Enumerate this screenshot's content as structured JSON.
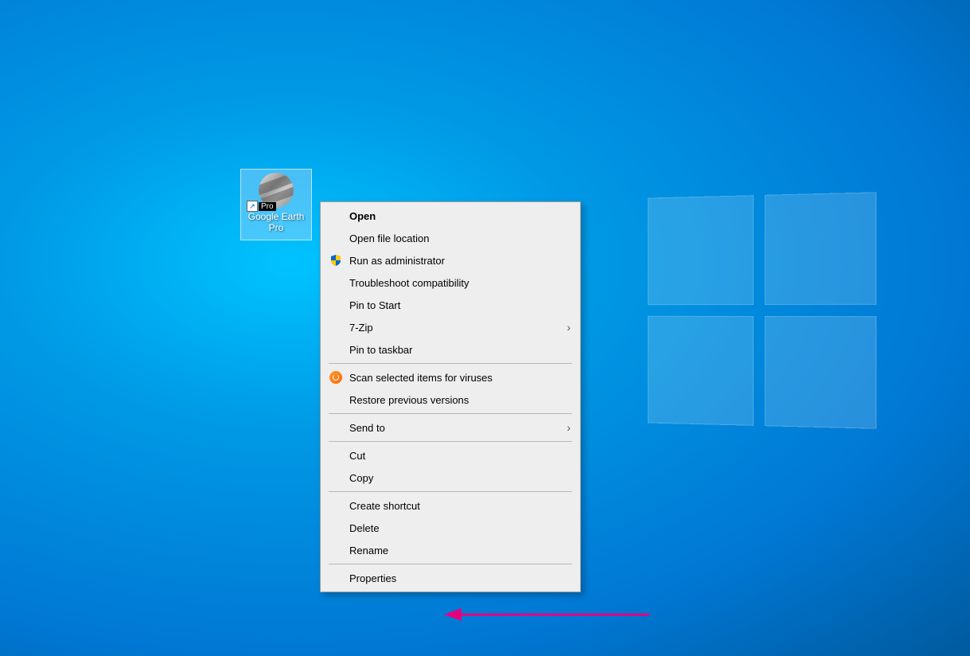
{
  "desktop_icon": {
    "label": "Google Earth Pro",
    "badge": "Pro"
  },
  "context_menu": {
    "items": [
      {
        "label": "Open",
        "bold": true,
        "icon": null,
        "submenu": false
      },
      {
        "label": "Open file location",
        "bold": false,
        "icon": null,
        "submenu": false
      },
      {
        "label": "Run as administrator",
        "bold": false,
        "icon": "shield",
        "submenu": false
      },
      {
        "label": "Troubleshoot compatibility",
        "bold": false,
        "icon": null,
        "submenu": false
      },
      {
        "label": "Pin to Start",
        "bold": false,
        "icon": null,
        "submenu": false
      },
      {
        "label": "7-Zip",
        "bold": false,
        "icon": null,
        "submenu": true
      },
      {
        "label": "Pin to taskbar",
        "bold": false,
        "icon": null,
        "submenu": false
      },
      {
        "separator": true
      },
      {
        "label": "Scan selected items for viruses",
        "bold": false,
        "icon": "scan",
        "submenu": false
      },
      {
        "label": "Restore previous versions",
        "bold": false,
        "icon": null,
        "submenu": false
      },
      {
        "separator": true
      },
      {
        "label": "Send to",
        "bold": false,
        "icon": null,
        "submenu": true
      },
      {
        "separator": true
      },
      {
        "label": "Cut",
        "bold": false,
        "icon": null,
        "submenu": false
      },
      {
        "label": "Copy",
        "bold": false,
        "icon": null,
        "submenu": false
      },
      {
        "separator": true
      },
      {
        "label": "Create shortcut",
        "bold": false,
        "icon": null,
        "submenu": false
      },
      {
        "label": "Delete",
        "bold": false,
        "icon": null,
        "submenu": false
      },
      {
        "label": "Rename",
        "bold": false,
        "icon": null,
        "submenu": false
      },
      {
        "separator": true
      },
      {
        "label": "Properties",
        "bold": false,
        "icon": null,
        "submenu": false
      }
    ]
  },
  "annotation": {
    "target": "Properties",
    "color": "#e6007e"
  }
}
